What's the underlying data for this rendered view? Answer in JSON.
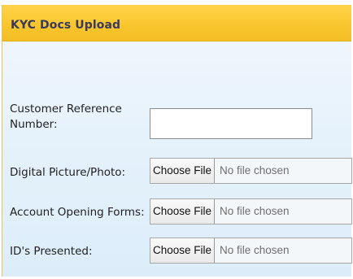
{
  "header": {
    "title": "KYC Docs Upload"
  },
  "form": {
    "customer_reference": {
      "label_line1": "Customer Reference",
      "label_line2": "Number:",
      "value": ""
    },
    "digital_picture": {
      "label": "Digital Picture/Photo:",
      "button_label": "Choose File",
      "status": "No file chosen"
    },
    "account_opening_forms": {
      "label": "Account Opening Forms:",
      "button_label": "Choose File",
      "status": "No file chosen"
    },
    "ids_presented": {
      "label": "ID's Presented:",
      "button_label": "Choose File",
      "status": "No file chosen"
    }
  },
  "colors": {
    "header_bg": "#f8c52c",
    "header_text": "#3a3a5a",
    "panel_bg": "#e4f1fb"
  }
}
